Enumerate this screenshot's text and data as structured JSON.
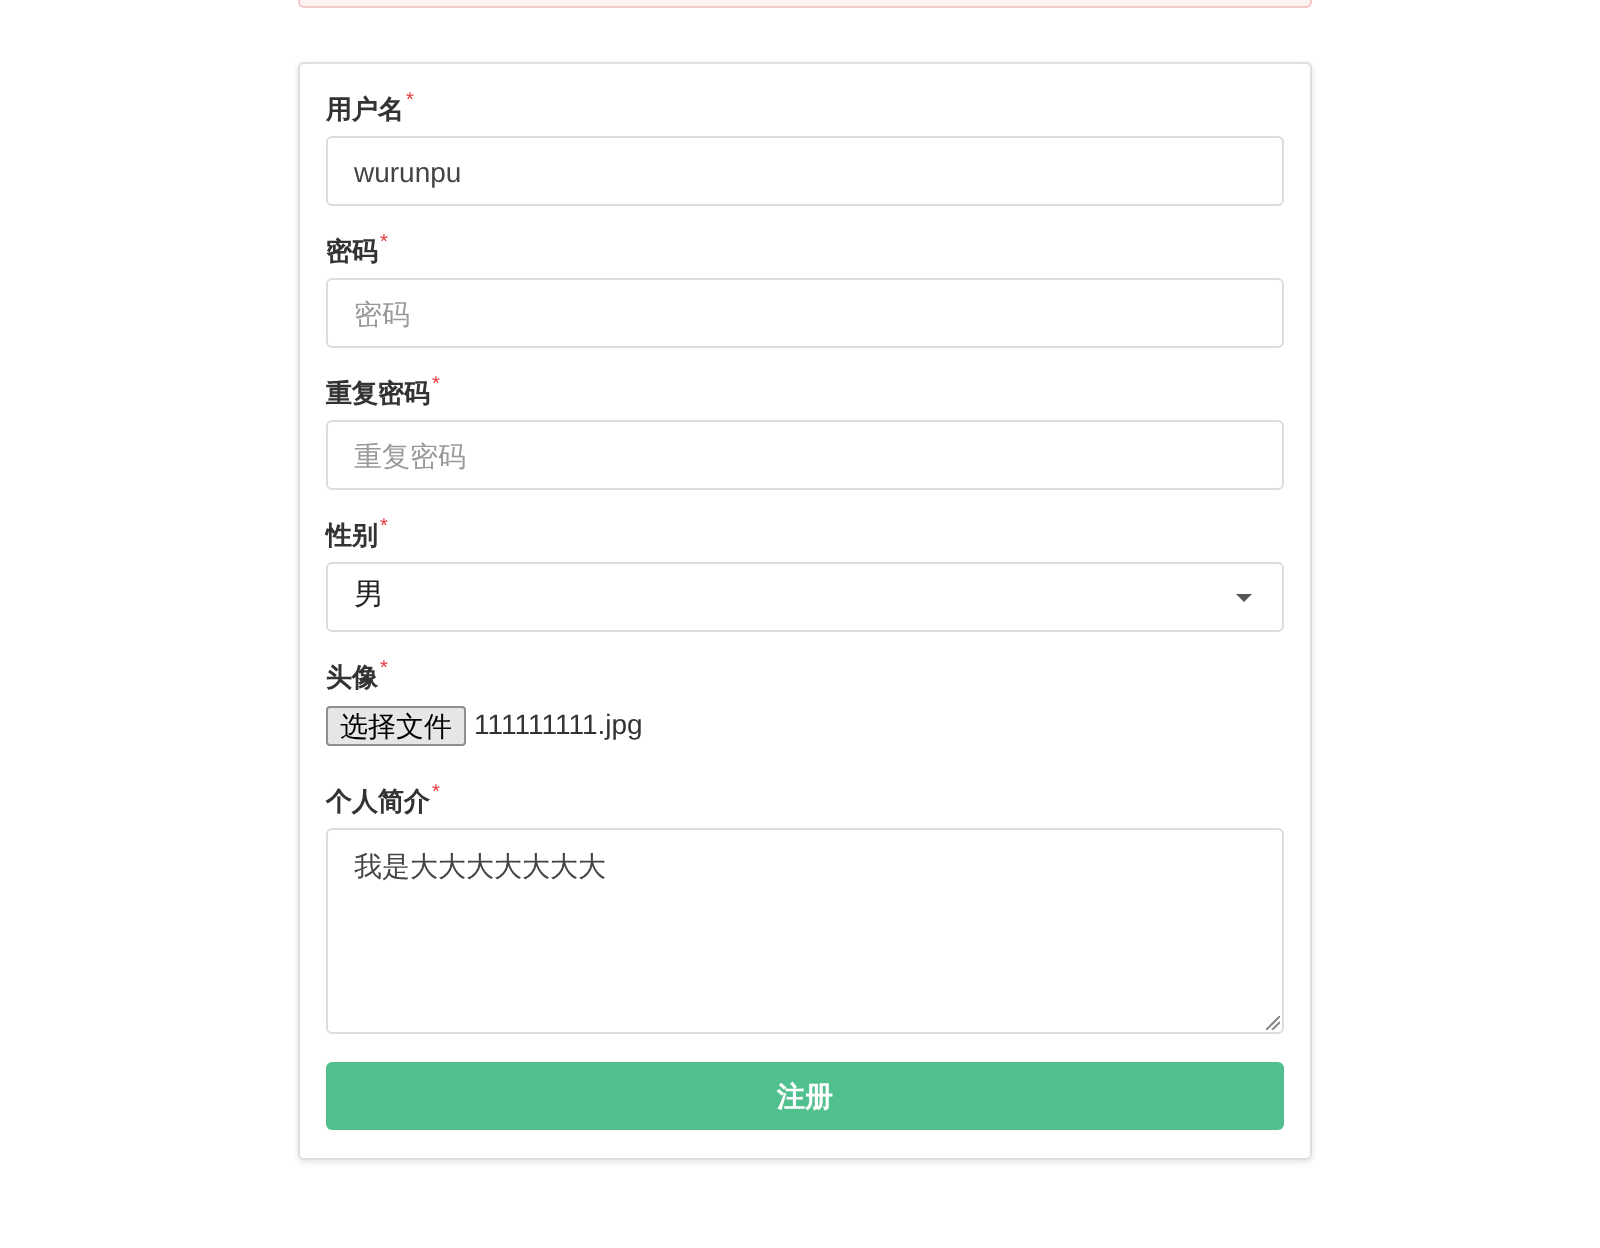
{
  "form": {
    "fields": [
      {
        "kind": "text",
        "label": "用户名",
        "required_mark": "*",
        "value": "wurunpu"
      },
      {
        "kind": "password",
        "label": "密码",
        "required_mark": "*",
        "placeholder": "密码"
      },
      {
        "kind": "password",
        "label": "重复密码",
        "required_mark": "*",
        "placeholder": "重复密码"
      },
      {
        "kind": "select",
        "label": "性别",
        "required_mark": "*",
        "value": "男"
      },
      {
        "kind": "file",
        "label": "头像",
        "required_mark": "*",
        "button": "选择文件",
        "value": "111111111.jpg"
      },
      {
        "kind": "textarea",
        "label": "个人简介",
        "required_mark": "*",
        "value": "我是大大大大大大大"
      }
    ],
    "submit": "注册"
  }
}
